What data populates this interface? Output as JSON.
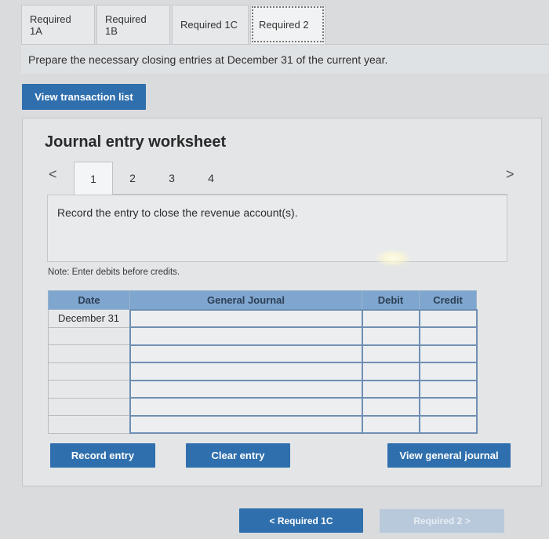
{
  "tabs": [
    {
      "label": "Required 1A"
    },
    {
      "label": "Required 1B"
    },
    {
      "label": "Required 1C"
    },
    {
      "label": "Required 2"
    }
  ],
  "instruction": "Prepare the necessary closing entries at December 31 of the current year.",
  "view_transaction_list": "View transaction list",
  "worksheet": {
    "title": "Journal entry worksheet",
    "nav_prev": "<",
    "nav_next": ">",
    "steps": [
      "1",
      "2",
      "3",
      "4"
    ],
    "active_step": "1",
    "description": "Record the entry to close the revenue account(s).",
    "note": "Note: Enter debits before credits."
  },
  "table": {
    "headers": {
      "date": "Date",
      "journal": "General Journal",
      "debit": "Debit",
      "credit": "Credit"
    },
    "first_date": "December 31"
  },
  "buttons": {
    "record": "Record entry",
    "clear": "Clear entry",
    "view_journal": "View general journal",
    "prev_label": "< Required 1C",
    "next_label": "Required 2 >"
  },
  "colors": {
    "accent": "#2f6fad",
    "table_header": "#7fa6cf"
  }
}
